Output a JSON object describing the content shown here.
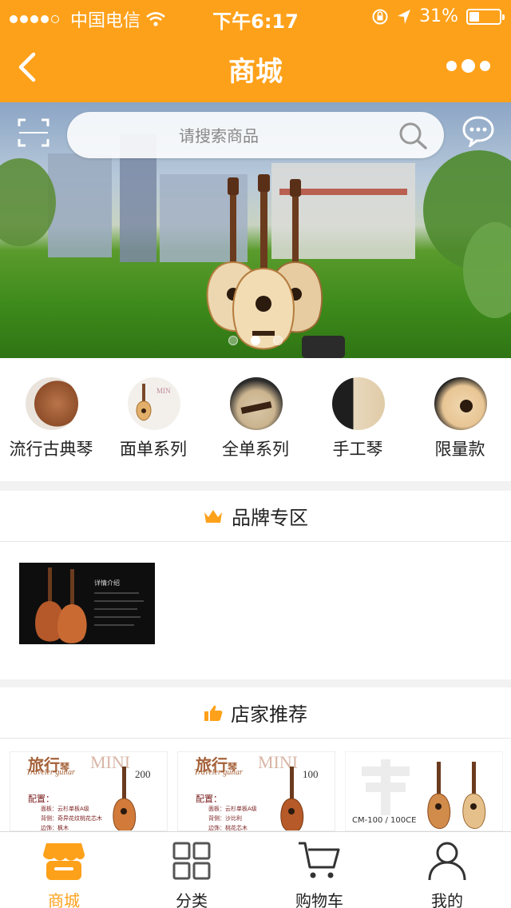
{
  "status": {
    "carrier": "中国电信",
    "time": "下午6:17",
    "battery": "31%"
  },
  "nav": {
    "title": "商城"
  },
  "search": {
    "placeholder": "请搜索商品"
  },
  "banner": {
    "slides": 3,
    "active": 2
  },
  "categories": [
    {
      "label": "流行古典琴"
    },
    {
      "label": "面单系列"
    },
    {
      "label": "全单系列"
    },
    {
      "label": "手工琴"
    },
    {
      "label": "限量款"
    }
  ],
  "brand": {
    "title": "品牌专区"
  },
  "recommend": {
    "title": "店家推荐"
  },
  "products": [
    {
      "title": "旅行",
      "title_small": "琴",
      "subtitle": "Traveler guitar",
      "mini": "MINI",
      "num": "200",
      "config": "配置：",
      "l1": "面板：云杉单板A级",
      "l2": "背侧：奇异花纹桃花芯木",
      "l3": "边饰：枫木"
    },
    {
      "title": "旅行",
      "title_small": "琴",
      "subtitle": "Traveler guitar",
      "mini": "MINI",
      "num": "100",
      "config": "配置：",
      "l1": "面板：云杉单板A级",
      "l2": "背侧：沙比利",
      "l3": "边饰：桃花芯木"
    },
    {
      "model": "CM-100 / 100CE"
    }
  ],
  "tabs": [
    {
      "label": "商城",
      "icon": "store-icon"
    },
    {
      "label": "分类",
      "icon": "grid-icon"
    },
    {
      "label": "购物车",
      "icon": "cart-icon"
    },
    {
      "label": "我的",
      "icon": "user-icon"
    }
  ],
  "colors": {
    "accent": "#fea11a",
    "background": "#f2f2f2"
  }
}
